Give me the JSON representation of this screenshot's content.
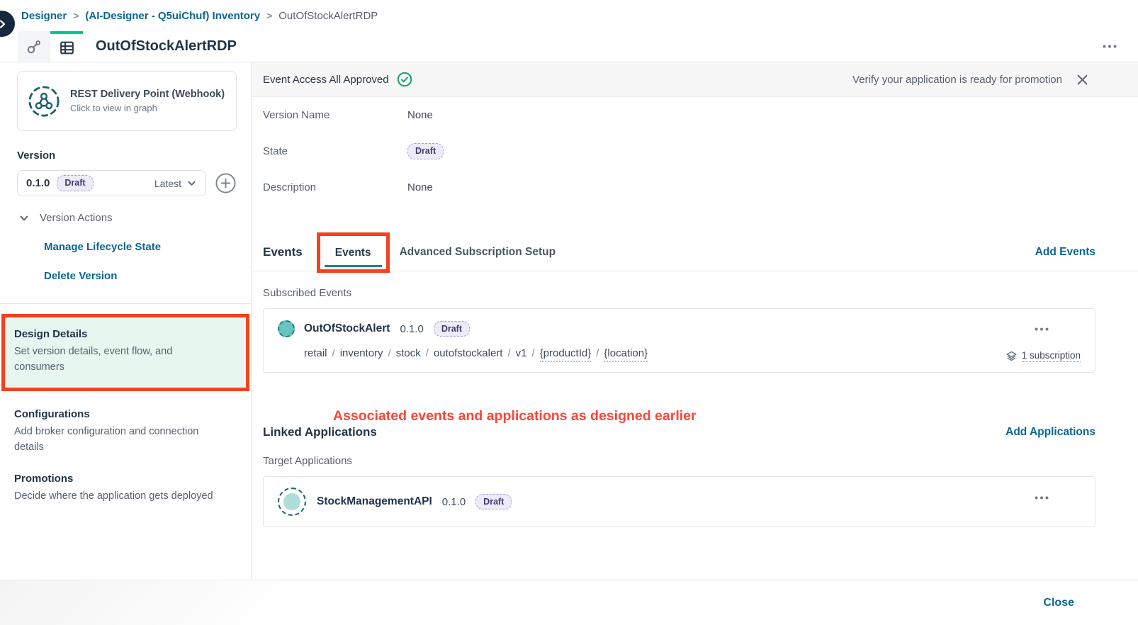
{
  "colors": {
    "link_blue": "#0B6591",
    "tab_underline_teal": "#17858B",
    "active_tab_green": "#00C791",
    "annotation_box_red": "#F2421F",
    "annotation_text_red": "#FA4638",
    "success_green": "#19A266",
    "badge_bg": "#EDEBF8",
    "badge_text": "#3D3A75",
    "highlight_mint": "#E7F6EF",
    "icon_teal_dark": "#1D646B",
    "icon_teal_fill": "#68C5BE"
  },
  "icons": {
    "collapse_toggle": "chevron-right-circle",
    "graph_view_tab": "graph",
    "table_view_tab": "table-grid",
    "webhook": "webhook-dashed-circle",
    "add_version": "plus-circle",
    "expand": "chevron-down",
    "approved": "check-circle",
    "dismiss": "x",
    "event": "teal-dashed-circle",
    "application": "teal-dashed-ring",
    "subscription": "layers",
    "menu": "ellipsis"
  },
  "breadcrumb": {
    "separator": ">",
    "items": [
      "Designer",
      "(AI-Designer - Q5uiChuf) Inventory",
      "OutOfStockAlertRDP"
    ]
  },
  "header": {
    "title": "OutOfStockAlertRDP"
  },
  "sidebar": {
    "type_card": {
      "title": "REST Delivery Point (Webhook)",
      "subtitle": "Click to view in graph"
    },
    "version_label": "Version",
    "version_select": {
      "value": "0.1.0",
      "state": "Draft",
      "tag": "Latest"
    },
    "version_actions_label": "Version Actions",
    "actions": [
      {
        "label": "Manage Lifecycle State"
      },
      {
        "label": "Delete Version"
      }
    ],
    "nav": [
      {
        "title": "Design Details",
        "desc": "Set version details, event flow, and consumers"
      },
      {
        "title": "Configurations",
        "desc": "Add broker configuration and connection details"
      },
      {
        "title": "Promotions",
        "desc": "Decide where the application gets deployed"
      }
    ]
  },
  "main": {
    "status": {
      "message": "Event Access All Approved",
      "promo": "Verify your application is ready for promotion"
    },
    "details": [
      {
        "label": "Version Name",
        "value": "None"
      },
      {
        "label": "State",
        "value": "Draft"
      },
      {
        "label": "Description",
        "value": "None"
      }
    ],
    "events": {
      "heading": "Events",
      "tab_active": "Events",
      "tab_secondary": "Advanced Subscription Setup",
      "action": "Add Events",
      "list_label": "Subscribed Events",
      "item": {
        "name": "OutOfStockAlert",
        "version": "0.1.0",
        "state": "Draft",
        "topic_separator": "/",
        "topic": [
          "retail",
          "inventory",
          "stock",
          "outofstockalert",
          "v1",
          "{productId}",
          "{location}"
        ],
        "subscription": "1 subscription"
      }
    },
    "annotation": "Associated events and applications as designed earlier",
    "applications": {
      "heading": "Linked Applications",
      "action": "Add Applications",
      "list_label": "Target Applications",
      "item": {
        "name": "StockManagementAPI",
        "version": "0.1.0",
        "state": "Draft"
      }
    },
    "footer": {
      "close": "Close"
    }
  }
}
